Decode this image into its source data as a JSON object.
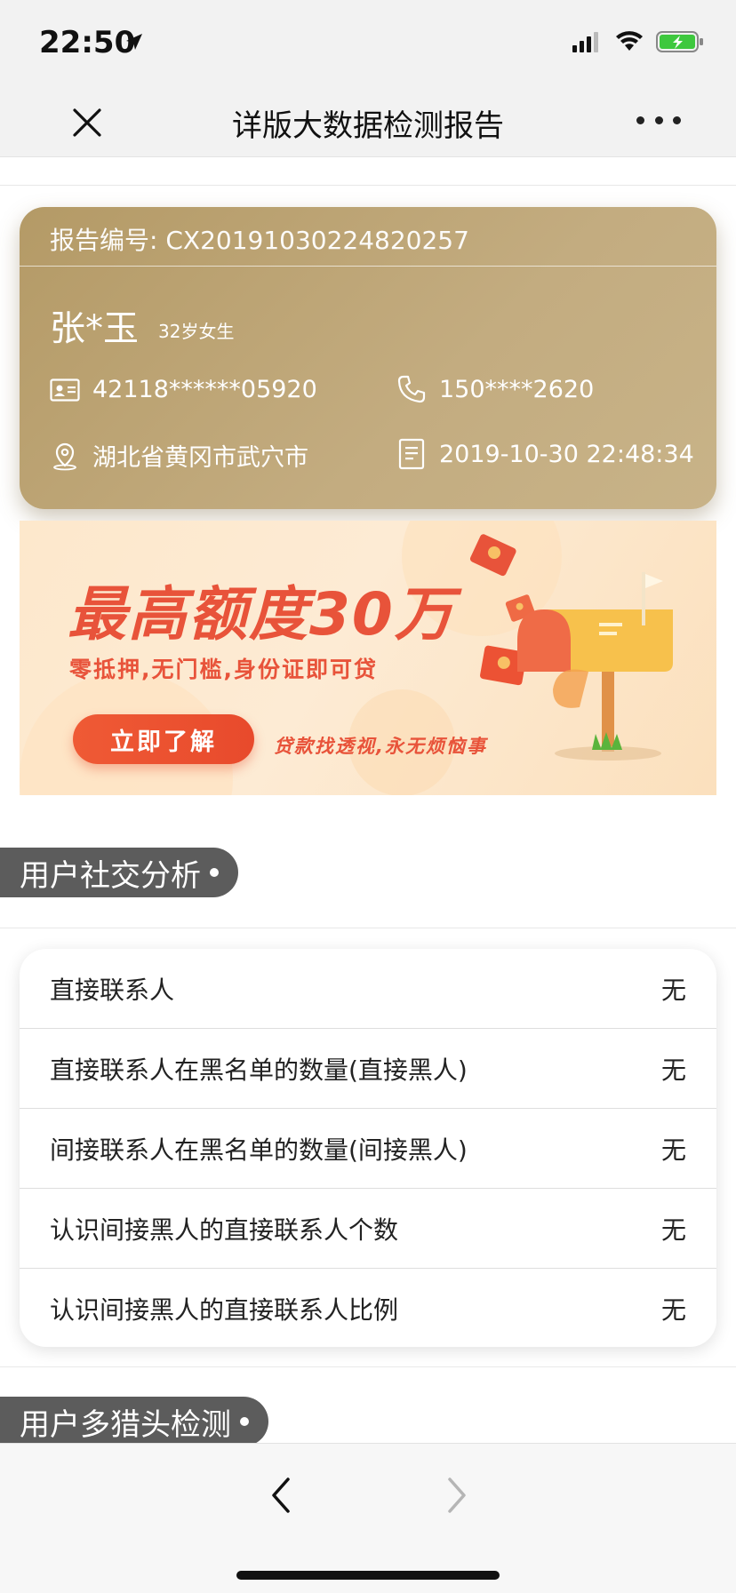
{
  "status_bar": {
    "time": "22:50"
  },
  "nav": {
    "title": "详版大数据检测报告"
  },
  "report": {
    "number_label": "报告编号:",
    "number": "CX20191030224820257",
    "name": "张*玉",
    "age_gender": "32岁女生",
    "id_number": "42118******05920",
    "phone": "150****2620",
    "location": "湖北省黄冈市武穴市",
    "datetime": "2019-10-30 22:48:34"
  },
  "banner": {
    "title": "最高额度30万",
    "subtitle": "零抵押,无门槛,身份证即可贷",
    "button_label": "立即了解",
    "slogan": "贷款找透视,永无烦恼事"
  },
  "social": {
    "section_title": "用户社交分析",
    "rows": [
      {
        "label": "直接联系人",
        "value": "无"
      },
      {
        "label": "直接联系人在黑名单的数量(直接黑人)",
        "value": "无"
      },
      {
        "label": "间接联系人在黑名单的数量(间接黑人)",
        "value": "无"
      },
      {
        "label": "认识间接黑人的直接联系人个数",
        "value": "无"
      },
      {
        "label": "认识间接黑人的直接联系人比例",
        "value": "无"
      }
    ]
  },
  "multi": {
    "section_title": "用户多猎头检测"
  },
  "colors": {
    "card_gold": "#b49a66",
    "banner_red": "#e8533a",
    "tab_gray": "#5c5c5c"
  }
}
